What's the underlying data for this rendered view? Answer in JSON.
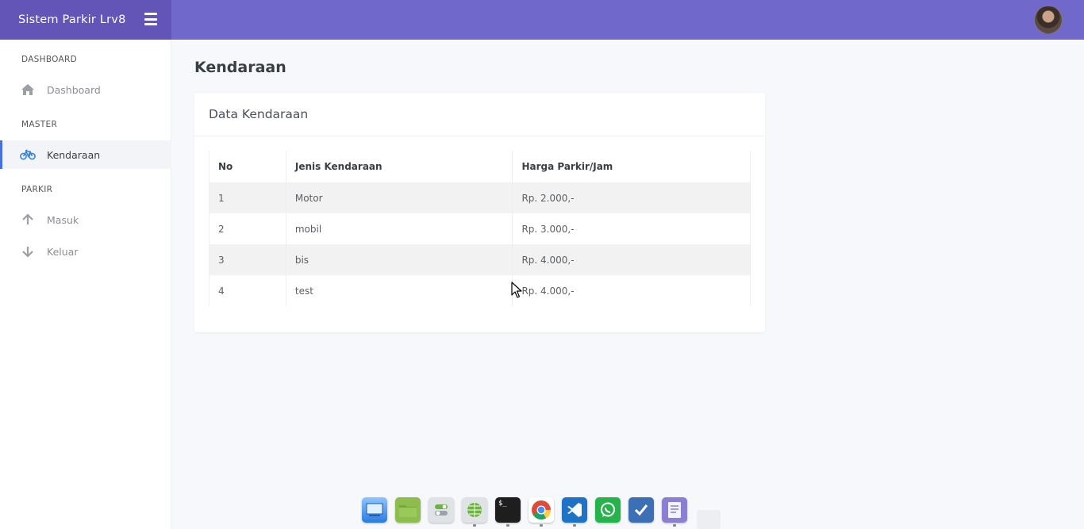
{
  "header": {
    "brand_title": "Sistem Parkir Lrv8"
  },
  "sidebar": {
    "sections": [
      {
        "label": "DASHBOARD",
        "items": [
          {
            "label": "Dashboard",
            "icon": "home-icon"
          }
        ]
      },
      {
        "label": "MASTER",
        "items": [
          {
            "label": "Kendaraan",
            "icon": "bicycle-icon",
            "active": true
          }
        ]
      },
      {
        "label": "PARKIR",
        "items": [
          {
            "label": "Masuk",
            "icon": "arrow-up-icon"
          },
          {
            "label": "Keluar",
            "icon": "arrow-down-icon"
          }
        ]
      }
    ]
  },
  "main": {
    "page_title": "Kendaraan",
    "card_title": "Data Kendaraan",
    "table": {
      "columns": [
        "No",
        "Jenis Kendaraan",
        "Harga Parkir/Jam"
      ],
      "rows": [
        [
          "1",
          "Motor",
          "Rp. 2.000,-"
        ],
        [
          "2",
          "mobil",
          "Rp. 3.000,-"
        ],
        [
          "3",
          "bis",
          "Rp. 4.000,-"
        ],
        [
          "4",
          "test",
          "Rp. 4.000,-"
        ]
      ]
    }
  },
  "dock": {
    "apps": [
      "screen-icon",
      "folder-icon",
      "settings-toggle-icon",
      "network-icon",
      "terminal-icon",
      "chrome-icon",
      "vscode-icon",
      "whatsapp-icon",
      "tasks-icon",
      "notes-icon"
    ],
    "terminal_glyph": "$_"
  },
  "colors": {
    "brand": "#6355b8",
    "topbar": "#7168cb",
    "active_accent": "#4a6fe0"
  }
}
